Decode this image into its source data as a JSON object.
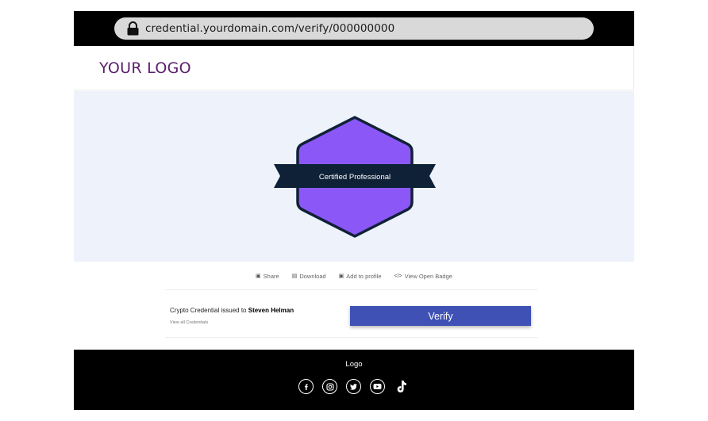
{
  "browser": {
    "url": "credential.yourdomain.com/verify/000000000"
  },
  "header": {
    "logo": "YOUR LOGO"
  },
  "badge": {
    "ribbon_text": "Certified Professional",
    "colors": {
      "fill": "#8b57f6",
      "outline": "#0f2137",
      "ribbon": "#0f2137"
    }
  },
  "actions": [
    {
      "label": "Share",
      "icon": "share-icon"
    },
    {
      "label": "Download",
      "icon": "download-icon"
    },
    {
      "label": "Add to profile",
      "icon": "linkedin-icon"
    },
    {
      "label": "View Open Badge",
      "icon": "code-icon"
    }
  ],
  "credential": {
    "issued_prefix": "Crypto Credential issued to",
    "recipient": "Steven Helman",
    "view_all": "View all Credentials",
    "verify_label": "Verify"
  },
  "footer": {
    "logo": "Logo",
    "socials": [
      "facebook-icon",
      "instagram-icon",
      "twitter-icon",
      "youtube-icon",
      "tiktok-icon"
    ]
  },
  "colors": {
    "accent": "#3f51b5",
    "logo_text": "#5b1f6b",
    "hero_bg": "#edf2fb"
  }
}
